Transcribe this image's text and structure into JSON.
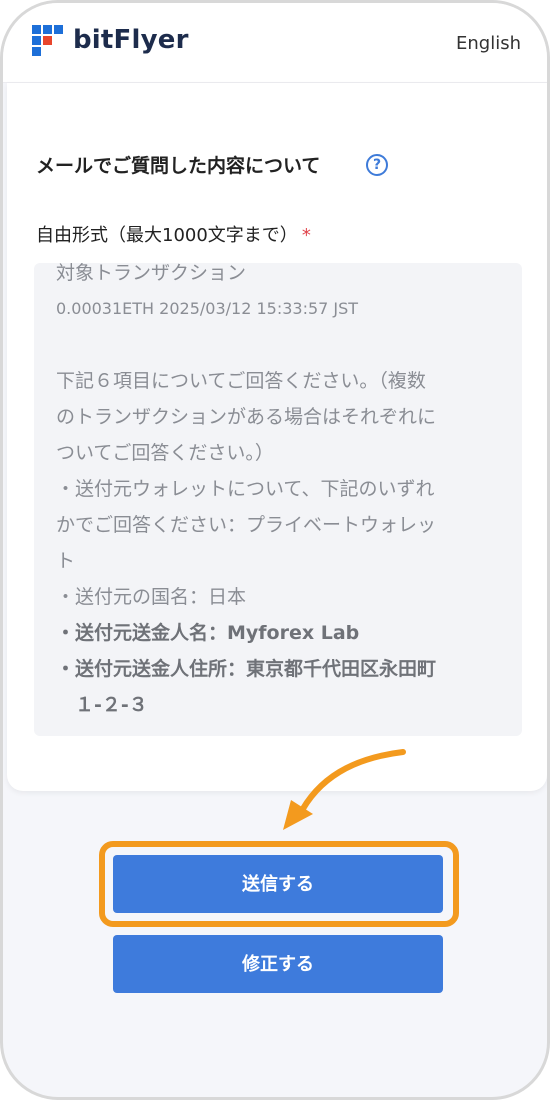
{
  "header": {
    "logo_text": "bitFlyer",
    "lang_link": "English",
    "brand_color": "#1d2c4c",
    "logo_accent": "#e8452c"
  },
  "form": {
    "section_title": "メールでご質問した内容について",
    "help_icon": "?",
    "field_label": "自由形式（最大1000文字まで）",
    "required_mark": "*",
    "textarea_lines": [
      "対象トランザクション",
      "0.00031ETH  2025/03/12 15:33:57 JST",
      "",
      "下記６項目についてご回答ください。（複数",
      "のトランザクションがある場合はそれぞれに",
      "ついてご回答ください。）",
      "・送付元ウォレットについて、下記のいずれ",
      "かでご回答ください：プライベートウォレッ",
      "ト",
      "・送付元の国名：日本",
      "・送付元送金人名：Myforex Lab",
      "・送付元送金人住所：東京都千代田区永田町",
      "　１-２-３"
    ]
  },
  "buttons": {
    "submit": "送信する",
    "edit": "修正する",
    "button_color": "#3e7bdc",
    "highlight_color": "#f39a1e"
  }
}
